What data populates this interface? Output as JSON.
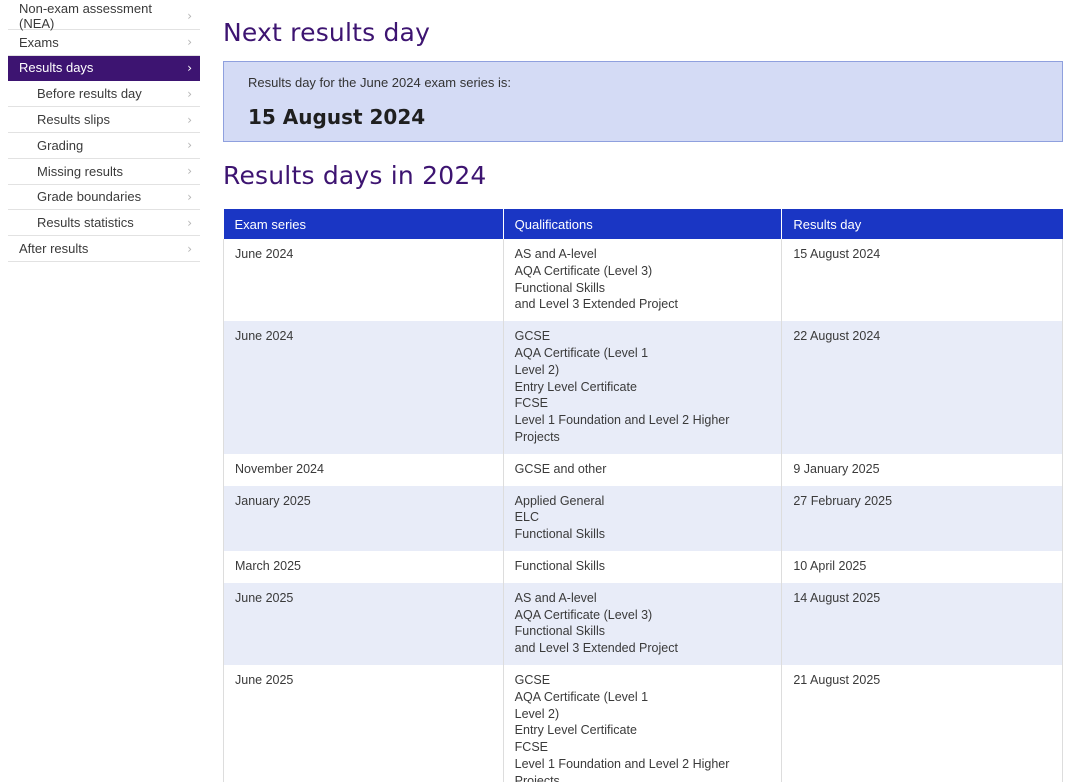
{
  "sidebar": {
    "items": [
      {
        "label": "Non-exam assessment (NEA)",
        "level": 0,
        "active": false
      },
      {
        "label": "Exams",
        "level": 0,
        "active": false
      },
      {
        "label": "Results days",
        "level": 0,
        "active": true
      },
      {
        "label": "Before results day",
        "level": 1,
        "active": false
      },
      {
        "label": "Results slips",
        "level": 1,
        "active": false
      },
      {
        "label": "Grading",
        "level": 1,
        "active": false
      },
      {
        "label": "Missing results",
        "level": 1,
        "active": false
      },
      {
        "label": "Grade boundaries",
        "level": 1,
        "active": false
      },
      {
        "label": "Results statistics",
        "level": 1,
        "active": false
      },
      {
        "label": "After results",
        "level": 0,
        "active": false
      }
    ],
    "chevron_icon": "chevron-right-icon"
  },
  "next_results": {
    "heading": "Next results day",
    "label": "Results day for the June 2024 exam series is:",
    "date": "15 August 2024"
  },
  "results_table": {
    "heading": "Results days in 2024",
    "headers": [
      "Exam series",
      "Qualifications",
      "Results day"
    ],
    "rows": [
      {
        "series": "June 2024",
        "qualifications": [
          "AS and A-level",
          "AQA Certificate (Level 3)",
          "Functional Skills",
          "and Level 3 Extended Project"
        ],
        "day": "15 August 2024"
      },
      {
        "series": "June 2024",
        "qualifications": [
          "GCSE",
          "AQA Certificate (Level 1",
          "Level 2)",
          "Entry Level Certificate",
          "FCSE",
          "Level 1 Foundation and Level 2 Higher",
          "Projects"
        ],
        "day": "22 August 2024"
      },
      {
        "series": "November 2024",
        "qualifications": [
          "GCSE and other"
        ],
        "day": "9 January 2025"
      },
      {
        "series": "January 2025",
        "qualifications": [
          "Applied General",
          "ELC",
          "Functional Skills"
        ],
        "day": "27 February 2025"
      },
      {
        "series": "March 2025",
        "qualifications": [
          "Functional Skills"
        ],
        "day": "10 April 2025"
      },
      {
        "series": "June 2025",
        "qualifications": [
          "AS and A-level",
          "AQA Certificate (Level 3)",
          "Functional Skills",
          "and Level 3 Extended Project"
        ],
        "day": "14 August 2025"
      },
      {
        "series": "June 2025",
        "qualifications": [
          "GCSE",
          "AQA Certificate (Level 1",
          "Level 2)",
          "Entry Level Certificate",
          "FCSE",
          "Level 1 Foundation and Level 2 Higher",
          "Projects"
        ],
        "day": "21 August 2025"
      }
    ]
  },
  "colors": {
    "brand_purple": "#3d1471",
    "header_blue": "#1a36c4",
    "panel_bg": "#d4dbf5",
    "row_alt": "#e8ecf8"
  }
}
